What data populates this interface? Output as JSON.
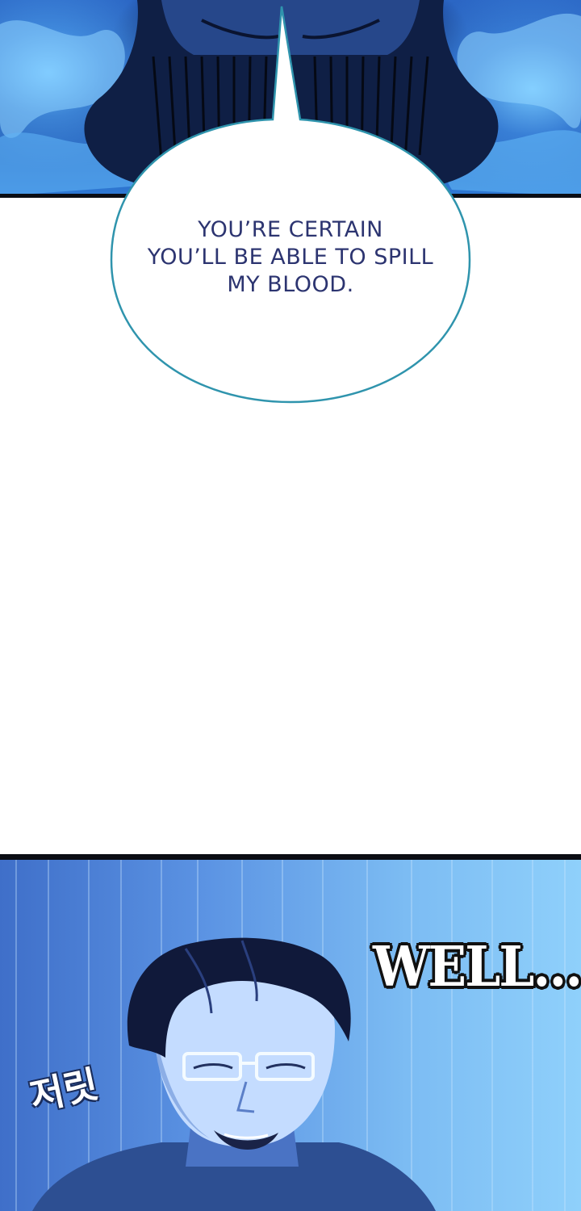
{
  "panels": {
    "top": {
      "bubble": {
        "lines": [
          "YOU’RE CERTAIN",
          "YOU’LL BE ABLE TO SPILL",
          "MY BLOOD."
        ]
      }
    },
    "bottom": {
      "sfx_main": "WELL...",
      "sfx_korean": "저릿"
    }
  },
  "colors": {
    "flame_blue": "#4fa3f0",
    "bubble_outline": "#2f94ad",
    "bubble_text": "#2c3470",
    "panel_border": "#0b0d14"
  }
}
